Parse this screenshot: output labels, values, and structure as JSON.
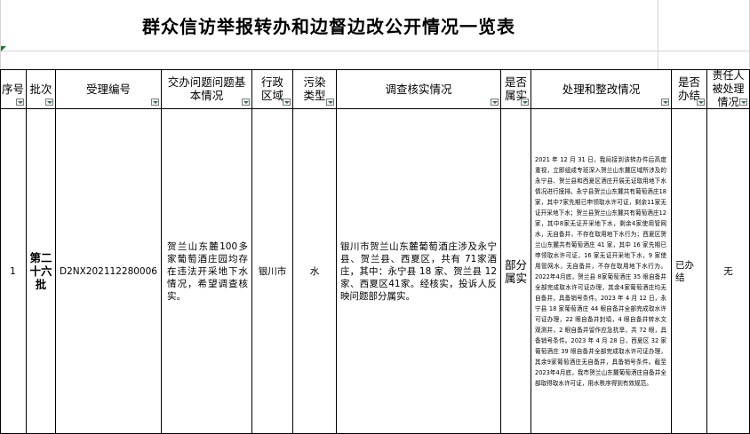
{
  "title": "群众信访举报转办和边督边改公开情况一览表",
  "headers": [
    "序号",
    "批次",
    "受理编号",
    "交办问题问题基本情况",
    "行政区域",
    "污染类型",
    "调查核实情况",
    "是否属实",
    "处理和整改情况",
    "是否办结",
    "责任人被处理情况"
  ],
  "row": {
    "seq": "1",
    "batch": "第二十六批",
    "case_no": "D2NX202112280006",
    "issue": "贺兰山东麓100多家葡萄酒庄园均存在违法开采地下水情况，希望调查核实。",
    "region": "银川市",
    "pollution": "水",
    "investigation": "银川市贺兰山东麓葡萄酒庄涉及永宁县、贺兰县、西夏区，共有 71家酒庄，其中：永宁县 18 家、贺兰县 12 家、西夏区41家。经核实，投诉人反映问题部分属实。",
    "verified": "部分属实",
    "handling": "2021 年 12 月 31 日，我局接到该转办件后高度重视，立即组成专班深入贺兰山东麓区域所涉及的永宁县、贺兰县和西夏区酒庄开展无证取用地下水情况进行摸排。永宁县贺兰山东麓共有葡萄酒庄18家，其中7家先期已申领取水许可证，剩余11家无证开采地下水；贺兰县贺兰山东麓共有葡萄酒庄12家，其中8家无证开采地下水，剩余4家使用管网水，无自备井，不存在取用地下水行为；西夏区贺兰山东麓共有葡萄酒庄 41 家，其中 16 家先期已申领取水许可证，16 家无证开采地下水，9 家使用管网水，无自备井，不存在取用地下水行为。2022年4月底，贺兰县 8家葡萄酒庄 35 眼自备井全部完成取水许可证办理，其余4家葡萄酒庄均无自备井，具备销号条件。2023 年 4 月 12 日，永宁县 18 家葡萄酒庄 44 眼自备井全部完成取水许可证办理，22 眼自备井封填，4 眼自备井转水文观测井，2 眼自备井留作应急抗旱，共 72 眼，具备销号条件。2023 年 4 月 28 日，西夏区 32 家葡萄酒庄 39 眼自备井全部完成取水许可证办理，其余9家葡萄酒庄无自备井，具备销号条件。截至2023年4月底，我市贺兰山东麓葡萄酒庄自备井全部取得取水许可证，用水秩序得到有效规范。",
    "closed": "已办结",
    "responsible": "无"
  }
}
